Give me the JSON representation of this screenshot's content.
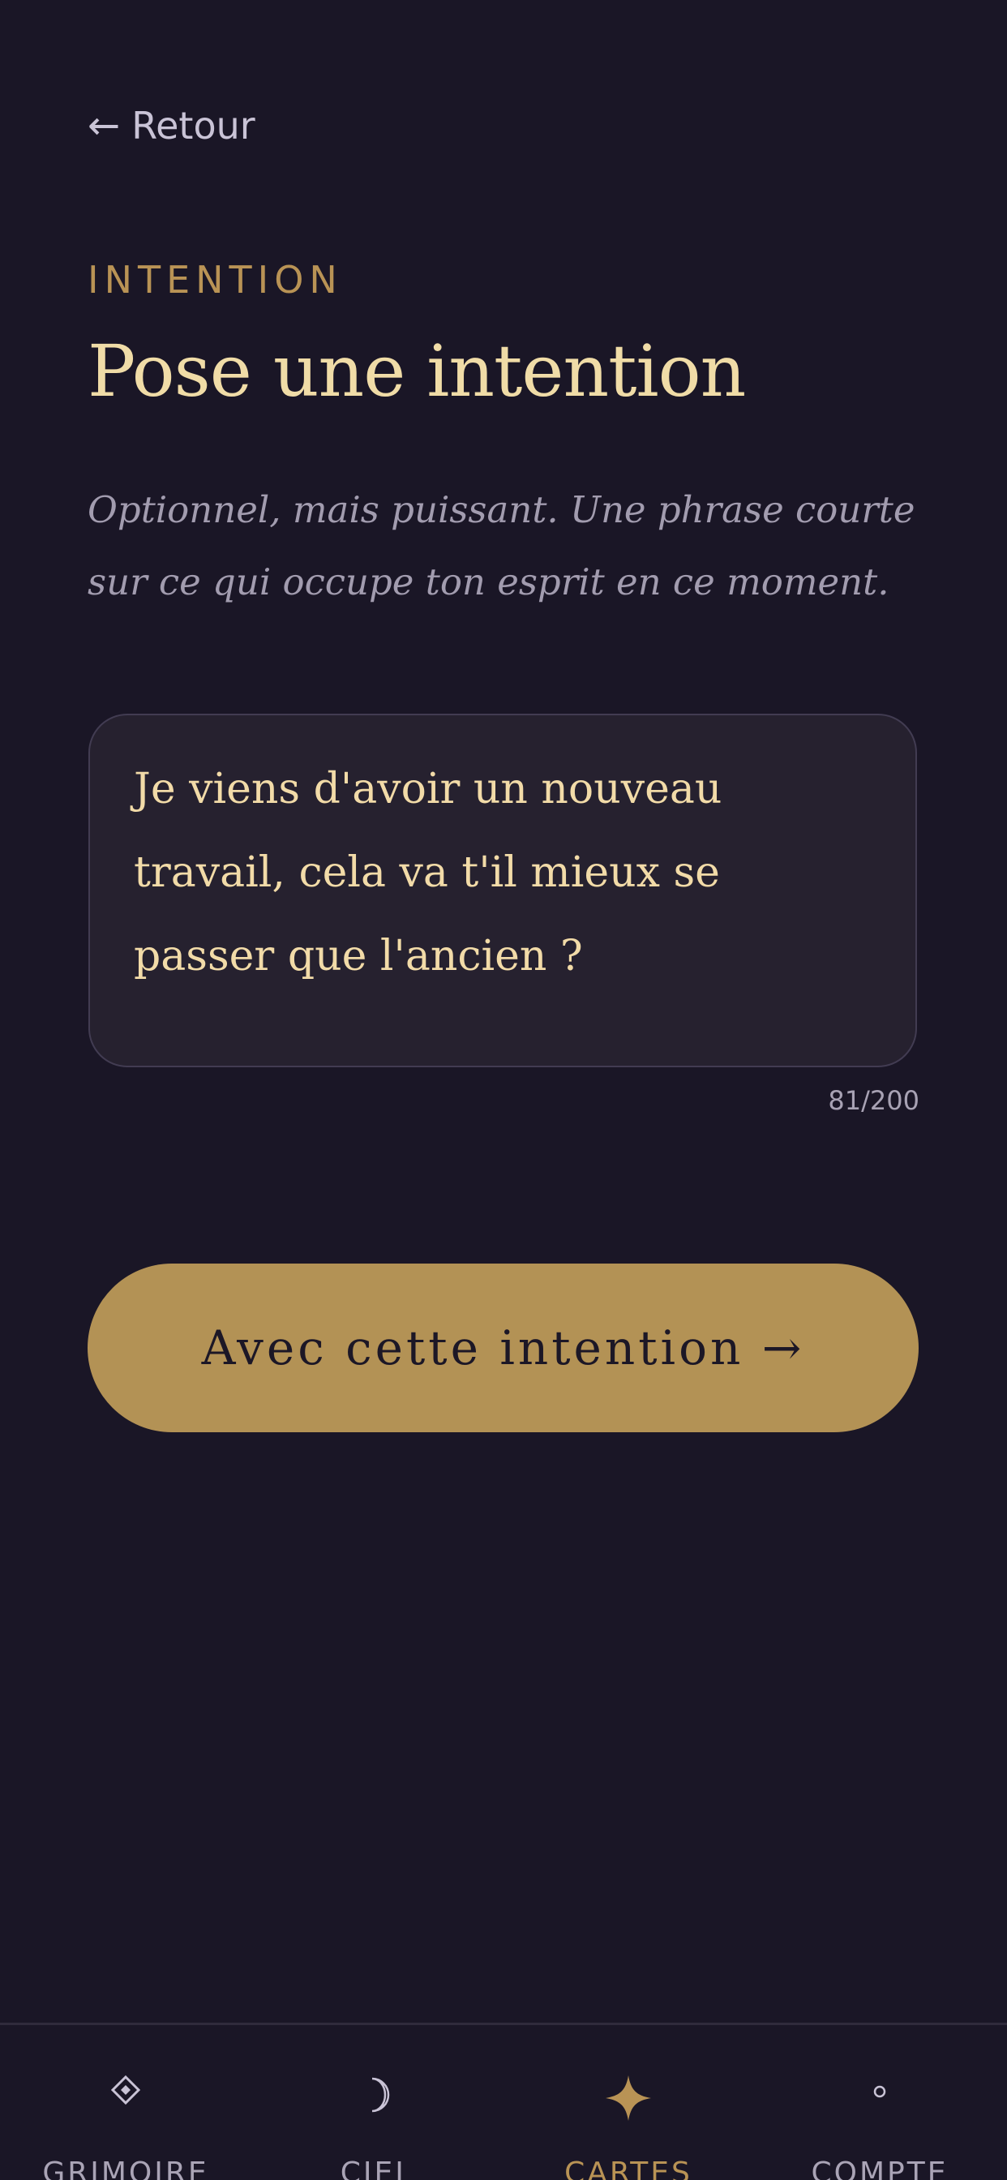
{
  "header": {
    "back_label": "Retour"
  },
  "content": {
    "eyebrow": "INTENTION",
    "title": "Pose une intention",
    "subtitle": "Optionnel, mais puissant. Une phrase courte sur ce qui occupe ton esprit en ce moment."
  },
  "intention": {
    "value": "Je viens d'avoir un nouveau travail, cela va t'il mieux se passer que l'ancien ?",
    "counter": "81/200"
  },
  "submit": {
    "label": "Avec cette intention →"
  },
  "tabs": [
    {
      "label": "GRIMOIRE",
      "icon": "diamond-icon",
      "active": false
    },
    {
      "label": "CIEL",
      "icon": "crescent-moon-icon",
      "active": false
    },
    {
      "label": "CARTES",
      "icon": "four-point-star-icon",
      "active": true
    },
    {
      "label": "COMPTE",
      "icon": "small-circle-icon",
      "active": false
    }
  ],
  "colors": {
    "background": "#1a1626",
    "accent_gold": "#b39255",
    "text_cream": "#f0dca7",
    "muted": "#a29caf"
  }
}
